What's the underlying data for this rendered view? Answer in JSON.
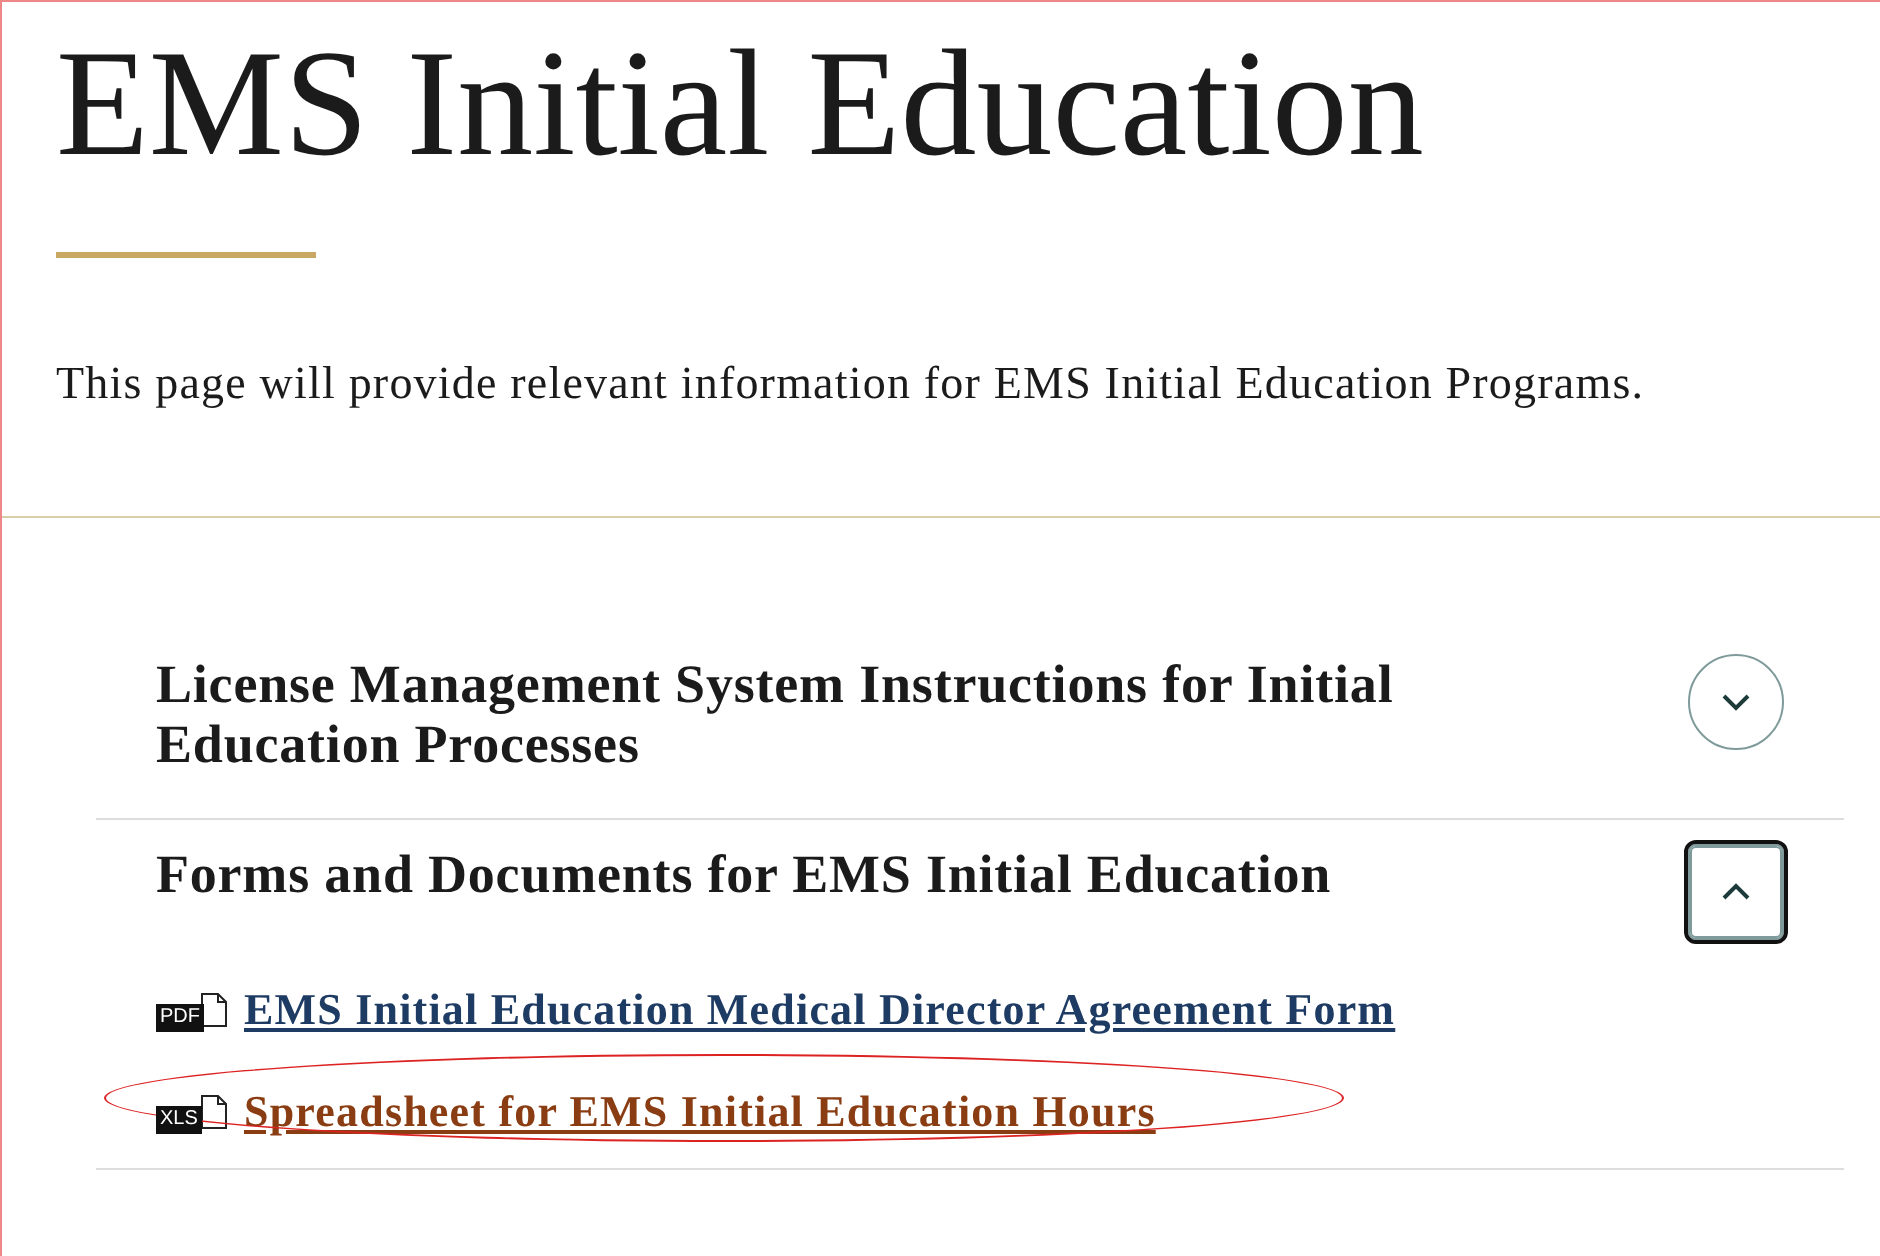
{
  "page": {
    "title": "EMS Initial Education",
    "intro": "This page will provide relevant information for EMS Initial Education Programs."
  },
  "accordion": [
    {
      "title": "License Management System Instructions for Initial Education Processes",
      "expanded": false
    },
    {
      "title": "Forms and Documents for EMS Initial Education",
      "expanded": true,
      "documents": [
        {
          "badge": "PDF",
          "label": "EMS Initial Education Medical Director Agreement Form",
          "visited": false,
          "highlighted": false
        },
        {
          "badge": "XLS",
          "label": "Spreadsheet for EMS Initial Education Hours",
          "visited": true,
          "highlighted": true
        }
      ]
    }
  ]
}
